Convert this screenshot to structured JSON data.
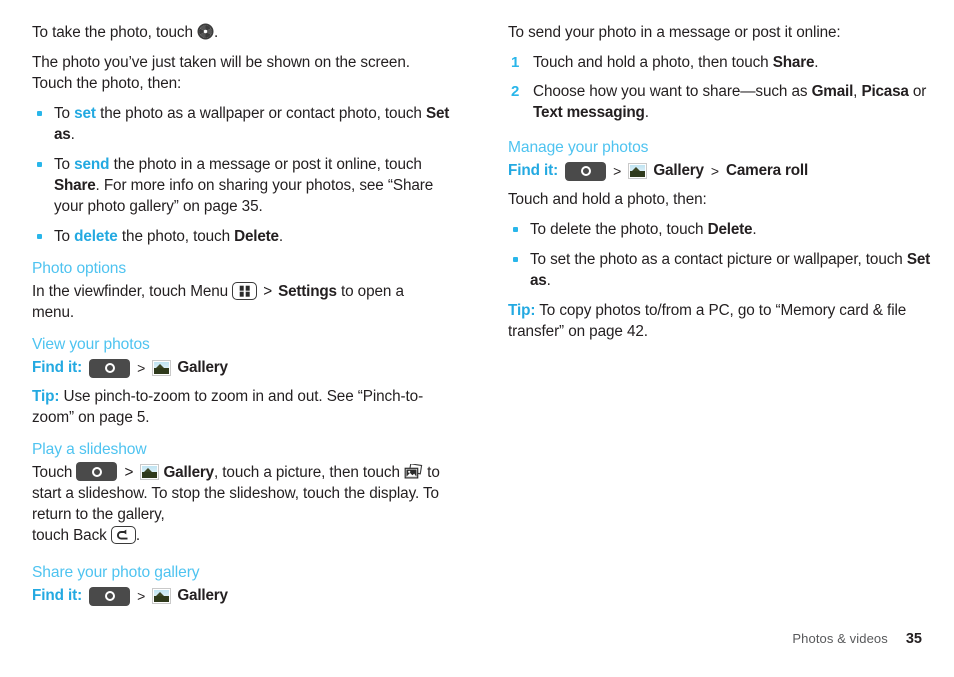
{
  "colors": {
    "accent_heading": "#4ec3f0",
    "accent_bold": "#23a9e1",
    "bullet": "#29b6ea",
    "body_text": "#231f20",
    "footer_text": "#58595b"
  },
  "left_column": {
    "intro_1_before": "To take the photo, touch ",
    "intro_1_after": ".",
    "intro_2": "The photo you’ve just taken will be shown on the screen. Touch the photo, then:",
    "bullets": [
      {
        "part1": "To ",
        "keyword": "set",
        "part2": " the photo as a wallpaper or contact photo, touch ",
        "bold1": "Set as",
        "part3": "."
      },
      {
        "part1": "To ",
        "keyword": "send",
        "part2": " the photo in a message or post it online, touch ",
        "bold1": "Share",
        "part3": ". For more info on sharing your photos, see “Share your photo gallery” on page 35."
      },
      {
        "part1": "To ",
        "keyword": "delete",
        "part2": " the photo, touch ",
        "bold1": "Delete",
        "part3": "."
      }
    ],
    "photo_options": {
      "heading": "Photo options",
      "text_before_icon": "In the viewfinder, touch Menu ",
      "arrow": ">",
      "settings_bold": "Settings",
      "text_after": " to open a menu."
    },
    "view_photos": {
      "heading": "View your photos",
      "find_it_label": "Find it:",
      "arrow": ">",
      "gallery_label": "Gallery",
      "tip_label": "Tip:",
      "tip_text": " Use pinch-to-zoom to zoom in and out. See “Pinch-to-zoom” on page 5."
    },
    "slideshow": {
      "heading": "Play a slideshow",
      "touch_word": "Touch ",
      "arrow": ">",
      "gallery_label": "Gallery",
      "text_mid": ", touch a picture, then touch ",
      "text_after_icon": " to start a slideshow. To stop the slideshow, touch the display. To return to the gallery,",
      "back_prefix": "touch Back ",
      "back_suffix": "."
    },
    "share_gallery": {
      "heading": "Share your photo gallery",
      "find_it_label": "Find it:",
      "arrow": ">",
      "gallery_label": "Gallery"
    }
  },
  "right_column": {
    "intro": "To send your photo in a message or post it online:",
    "steps": [
      {
        "num": "1",
        "part1": "Touch and hold a photo, then touch ",
        "bold1": "Share",
        "part2": "."
      },
      {
        "num": "2",
        "part1": "Choose how you want to share—such as ",
        "bold1": "Gmail",
        "part2": ", ",
        "bold2": "Picasa",
        "part3": " or ",
        "bold3": "Text messaging",
        "part4": "."
      }
    ],
    "manage": {
      "heading": "Manage your photos",
      "find_it_label": "Find it:",
      "arrow1": ">",
      "gallery_label": "Gallery",
      "arrow2": ">",
      "camera_roll_label": "Camera roll",
      "intro": "Touch and hold a photo, then:",
      "bullets": [
        {
          "part1": "To delete the photo, touch ",
          "bold1": "Delete",
          "part2": "."
        },
        {
          "part1": "To set the photo as a contact picture or wallpaper, touch ",
          "bold1": "Set as",
          "part2": "."
        }
      ],
      "tip_label": "Tip:",
      "tip_text": " To copy photos to/from a PC, go to “Memory card & file transfer” on page 42."
    }
  },
  "footer": {
    "chapter": "Photos & videos",
    "page_number": "35"
  },
  "icons": {
    "shutter": "camera-shutter-icon",
    "camera_key": "camera-app-icon",
    "gallery": "gallery-thumbnail-icon",
    "menu_key": "menu-key-icon",
    "back_key": "back-key-icon",
    "slideshow": "slideshow-icon"
  }
}
